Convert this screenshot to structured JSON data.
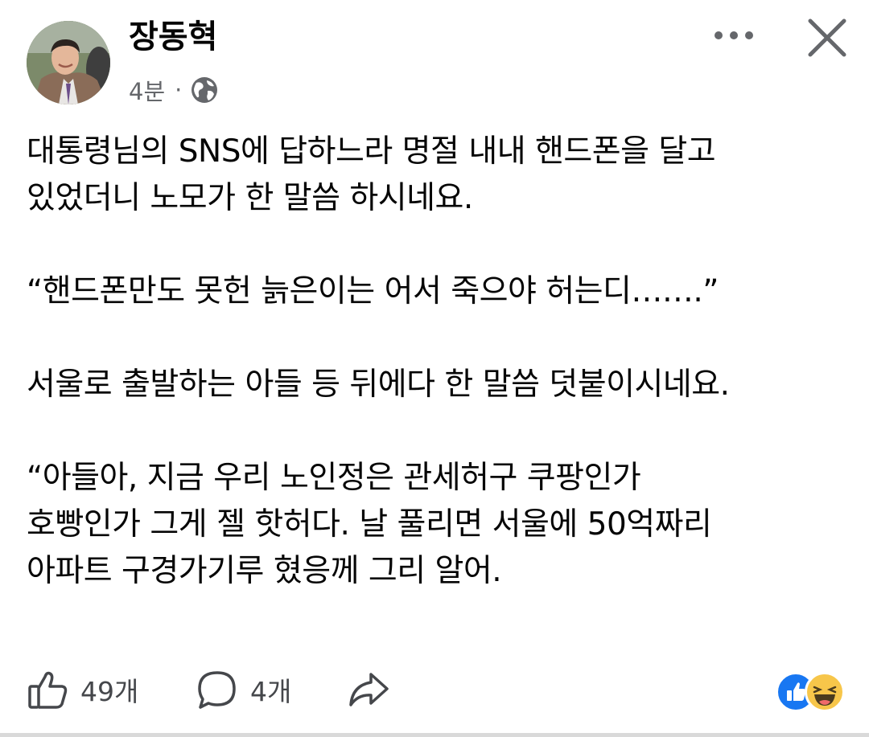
{
  "post": {
    "author": "장동혁",
    "time": "4분",
    "separator": "·",
    "privacy_icon": "globe-icon",
    "more_icon": "more-horizontal-icon",
    "close_icon": "close-icon",
    "lines": [
      "대통령님의 SNS에 답하느라 명절 내내 핸드폰을 달고",
      "있었더니 노모가 한 말씀 하시네요.",
      "",
      "“핸드폰만도 못헌 늙은이는 어서 죽으야 허는디…….”",
      "",
      "서울로 출발하는 아들 등 뒤에다 한 말씀 덧붙이시네요.",
      "",
      "“아들아, 지금 우리 노인정은 관세허구 쿠팡인가",
      "호빵인가 그게 젤 핫허다. 날 풀리면 서울에 50억짜리",
      "아파트 구경가기루 혔응께 그리 알어."
    ]
  },
  "actions": {
    "like_icon": "thumbs-up-icon",
    "like_count": "49개",
    "comment_icon": "comment-icon",
    "comment_count": "4개",
    "share_icon": "share-icon"
  },
  "reactions": [
    "like-reaction-icon",
    "haha-reaction-icon"
  ],
  "colors": {
    "text": "#050505",
    "secondary": "#65676b",
    "like_blue": "#1877f2",
    "haha_yellow": "#f7c64a"
  }
}
